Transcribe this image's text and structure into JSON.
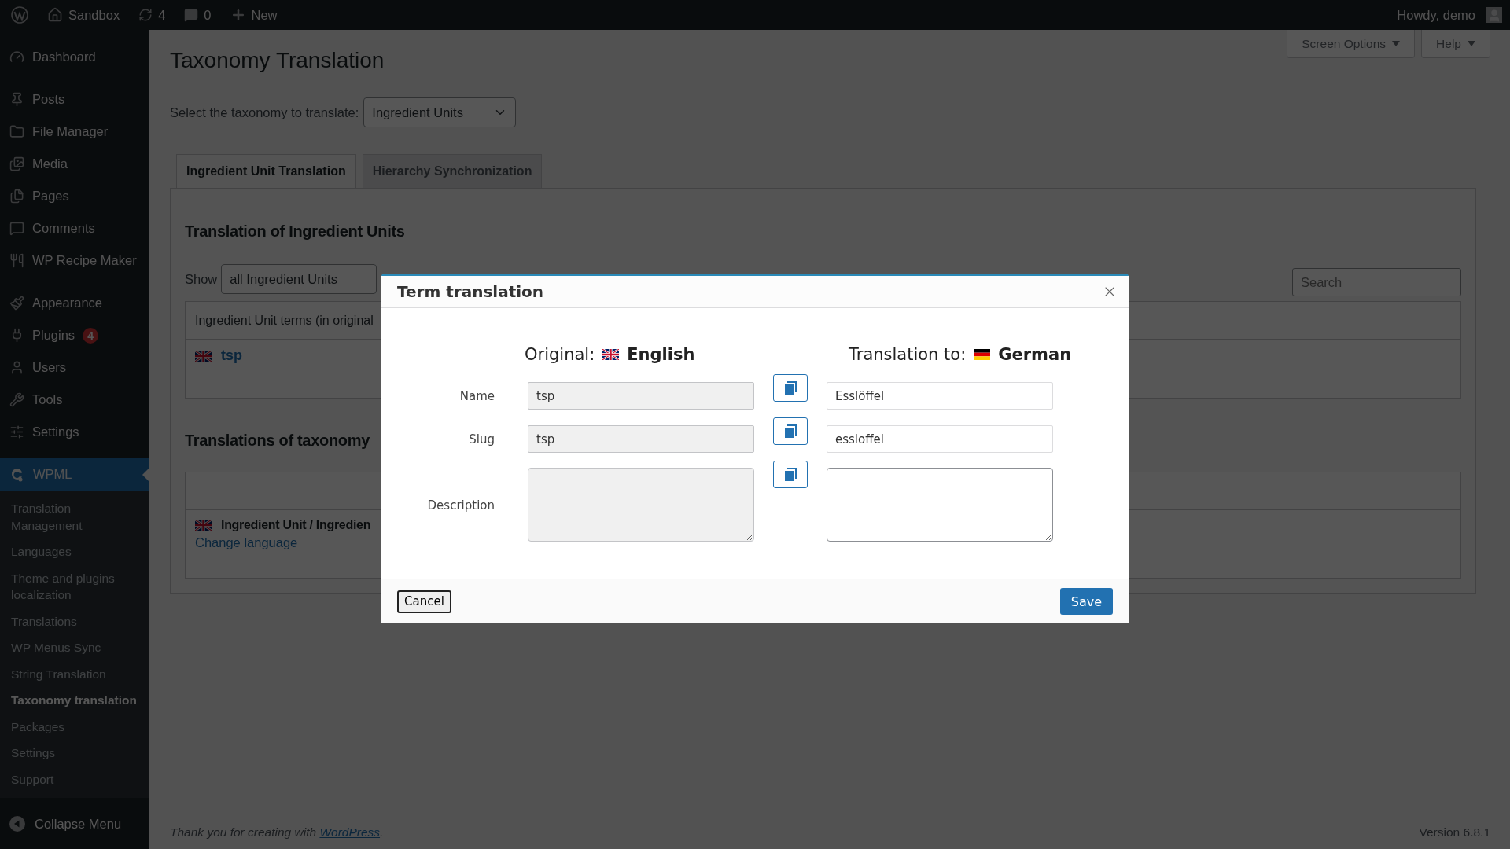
{
  "admin_bar": {
    "site": "Sandbox",
    "updates": "4",
    "comments": "0",
    "new": "New",
    "greeting": "Howdy, demo"
  },
  "sidebar": {
    "groups": [
      [
        {
          "label": "Dashboard",
          "selected": false
        }
      ],
      [
        {
          "label": "Posts",
          "selected": false
        },
        {
          "label": "File Manager",
          "selected": false
        },
        {
          "label": "Media",
          "selected": false
        },
        {
          "label": "Pages",
          "selected": false
        },
        {
          "label": "Comments",
          "selected": false
        },
        {
          "label": "WP Recipe Maker",
          "selected": false
        }
      ],
      [
        {
          "label": "Appearance",
          "selected": false
        },
        {
          "label": "Plugins",
          "badge": "4",
          "selected": false
        },
        {
          "label": "Users",
          "selected": false
        },
        {
          "label": "Tools",
          "selected": false
        },
        {
          "label": "Settings",
          "selected": false
        }
      ],
      [
        {
          "label": "WPML",
          "selected": true,
          "children": [
            {
              "label": "Translation Management",
              "selected": false
            },
            {
              "label": "Languages",
              "selected": false
            },
            {
              "label": "Theme and plugins localization",
              "selected": false
            },
            {
              "label": "Translations",
              "selected": false
            },
            {
              "label": "WP Menus Sync",
              "selected": false
            },
            {
              "label": "String Translation",
              "selected": false
            },
            {
              "label": "Taxonomy translation",
              "selected": true
            },
            {
              "label": "Packages",
              "selected": false
            },
            {
              "label": "Settings",
              "selected": false
            },
            {
              "label": "Support",
              "selected": false
            }
          ]
        }
      ]
    ],
    "collapse": "Collapse Menu"
  },
  "header": {
    "title": "Taxonomy Translation",
    "screen_options": "Screen Options",
    "help": "Help"
  },
  "taxonomy_select": {
    "label": "Select the taxonomy to translate:",
    "value": "Ingredient Units"
  },
  "tabs": [
    {
      "label": "Ingredient Unit Translation",
      "selected": true
    },
    {
      "label": "Hierarchy Synchronization",
      "selected": false
    }
  ],
  "panel": {
    "heading": "Translation of Ingredient Units",
    "show_label": "Show",
    "show_value": "all Ingredient Units",
    "search": {
      "placeholder": "Search"
    },
    "terms_table": {
      "column_1": "Ingredient Unit terms (in original",
      "rows": [
        {
          "term": "tsp"
        }
      ]
    },
    "heading_2": "Translations of taxonomy",
    "labels_table": {
      "rows": [
        {
          "title": "Ingredient Unit / Ingredien",
          "link": "Change language"
        }
      ]
    }
  },
  "footer": {
    "thanks_before": "Thank you for creating with ",
    "link": "WordPress",
    "thanks_after": ".",
    "version": "Version 6.8.1"
  },
  "dialog": {
    "title": "Term translation",
    "original": {
      "label": "Original:",
      "language": "English"
    },
    "translation": {
      "label": "Translation to:",
      "language": "German"
    },
    "rows": [
      {
        "kind": "input",
        "label": "Name",
        "original": "tsp",
        "translation": "Esslöffel"
      },
      {
        "kind": "input",
        "label": "Slug",
        "original": "tsp",
        "translation": "essloffel"
      },
      {
        "kind": "textarea",
        "label": "Description"
      }
    ],
    "cancel": "Cancel",
    "save": "Save"
  }
}
